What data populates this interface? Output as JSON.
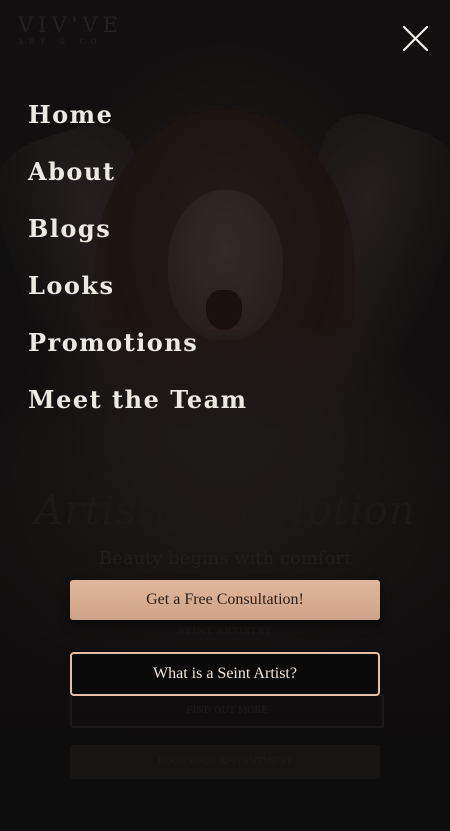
{
  "logo": {
    "mark": "VIV'VE",
    "sub": "ART & CO"
  },
  "nav": {
    "close_icon": "close-icon",
    "items": [
      {
        "label": "Home"
      },
      {
        "label": "About"
      },
      {
        "label": "Blogs"
      },
      {
        "label": "Looks"
      },
      {
        "label": "Promotions"
      },
      {
        "label": "Meet the Team"
      }
    ]
  },
  "hero": {
    "script_heading": "Artistry in Motion",
    "tagline": "Beauty begins with comfort",
    "small_note": "SEINT ARTISTRY",
    "outline_button": "FIND OUT MORE",
    "filled_button": "BOOK YOUR APPOINTMENT"
  },
  "cta": {
    "consultation": "Get a Free Consultation!",
    "seint": "What is a Seint Artist?"
  },
  "colors": {
    "nav_text": "#ece8e2",
    "accent_peach": "#e2b89d",
    "accent_border": "#e5bfa5",
    "background": "#121111"
  }
}
